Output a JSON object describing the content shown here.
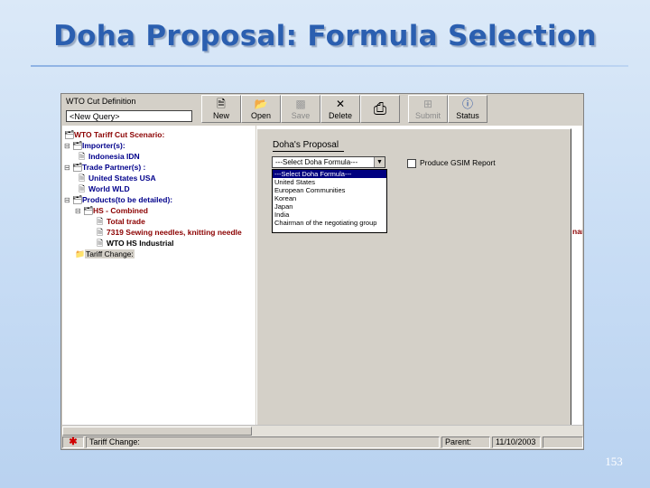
{
  "slide": {
    "title": "Doha Proposal: Formula Selection",
    "page_number": "153"
  },
  "query": {
    "label": "WTO Cut Definition",
    "value": "<New Query>"
  },
  "toolbar": {
    "buttons": [
      {
        "label": "New",
        "icon": "new-document-icon",
        "enabled": true
      },
      {
        "label": "Open",
        "icon": "open-folder-icon",
        "enabled": true
      },
      {
        "label": "Save",
        "icon": "save-disk-icon",
        "enabled": false
      },
      {
        "label": "Delete",
        "icon": "delete-x-icon",
        "enabled": true
      },
      {
        "label": "",
        "icon": "printer-icon",
        "enabled": true
      },
      {
        "label": "Submit",
        "icon": "submit-icon",
        "enabled": false
      },
      {
        "label": "Status",
        "icon": "status-help-icon",
        "enabled": true
      }
    ]
  },
  "tree": {
    "root": "WTO Tariff Cut Scenario:",
    "importers": "Importer(s):",
    "importer_1": "Indonesia  IDN",
    "partners": "Trade Partner(s) :",
    "partner_1": "United States  USA",
    "partner_2": "World  WLD",
    "products": "Products(to be detailed):",
    "hs_combined": "HS - Combined",
    "product_1": "Total trade",
    "product_2": "7319  Sewing needles, knitting needle",
    "product_3": "WTO HS Industrial",
    "tariff_change": "Tariff Change:"
  },
  "overflow_text": "nan",
  "doha": {
    "label": "Doha's Proposal",
    "select_value": "---Select Doha Formula---",
    "options": [
      "---Select Doha Formula---",
      "United States",
      "European Communities",
      "Korean",
      "Japan",
      "India",
      "Chairman of the negotiating group"
    ],
    "selected_index": 0,
    "gsim_label": "Produce GSIM Report",
    "gsim_checked": false
  },
  "status": {
    "item": "Tariff Change:",
    "parent_label": "Parent:",
    "date": "11/10/2003"
  },
  "colors": {
    "title": "#2b5fb0",
    "selection": "#000080",
    "tree_red": "#8b0000",
    "tree_blue": "#00008b"
  }
}
